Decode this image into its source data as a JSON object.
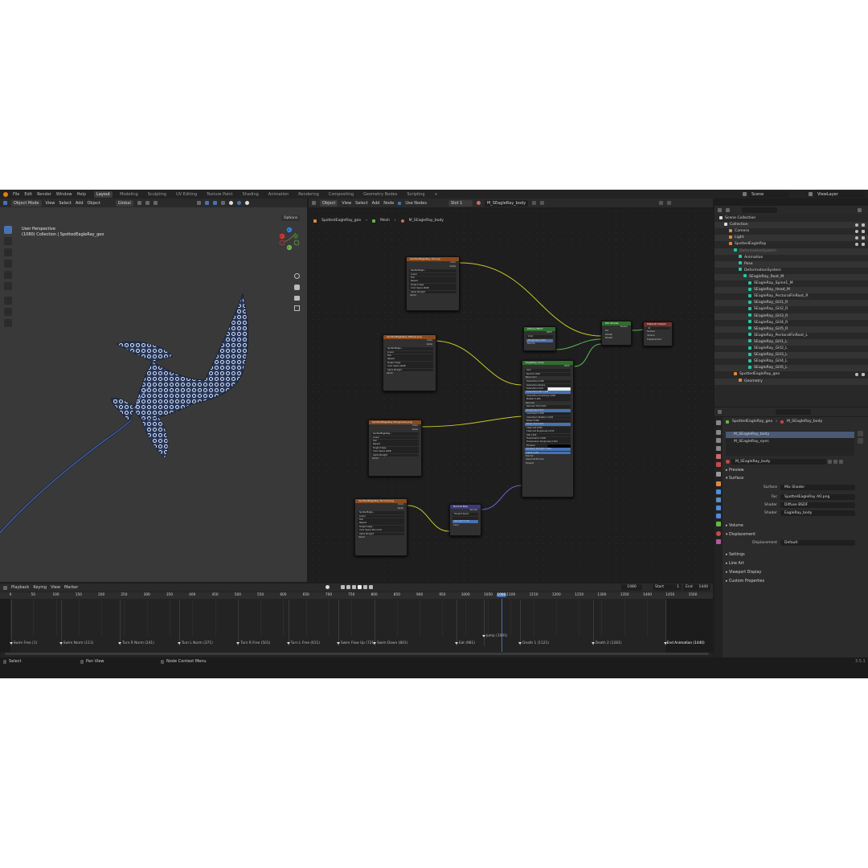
{
  "menu": [
    "File",
    "Edit",
    "Render",
    "Window",
    "Help"
  ],
  "workspaces": [
    "Layout",
    "Modeling",
    "Sculpting",
    "UV Editing",
    "Texture Paint",
    "Shading",
    "Animation",
    "Rendering",
    "Compositing",
    "Geometry Nodes",
    "Scripting",
    "+"
  ],
  "scene": {
    "name": "Scene",
    "view_layer": "ViewLayer"
  },
  "viewport": {
    "mode": "Object Mode",
    "menu": [
      "View",
      "Select",
      "Add",
      "Object"
    ],
    "orientation": "Global",
    "options": "Options",
    "title": "User Perspective",
    "subtitle": "(1080) Collection | SpottedEagleRay_geo",
    "gizmo": {
      "x": "X",
      "y": "Y",
      "z": "Z"
    }
  },
  "node_editor": {
    "type": "Object",
    "menu": [
      "View",
      "Select",
      "Add",
      "Node"
    ],
    "use_nodes": "Use Nodes",
    "slot": "Slot 1",
    "material": "M_SEagleRay_body",
    "breadcrumb": [
      "SpottedEagleRay_geo",
      "Mesh",
      "M_SEagleRay_body"
    ],
    "nodes": {
      "ao": {
        "title": "SpottedEagleRay AO.png",
        "outputs": [
          "Color",
          "Alpha"
        ],
        "file": "SpottedEagle...",
        "fields": [
          "Linear",
          "Flat",
          "Repeat",
          "Single Image",
          "Color Space   sRGB",
          "Alpha   Straight"
        ],
        "vector": "Vector"
      },
      "basecolor": {
        "title": "SpottedEagleRay Diffuse.png",
        "outputs": [
          "Color",
          "Alpha"
        ],
        "file": "SpottedEagle...",
        "fields": [
          "Linear",
          "Flat",
          "Repeat",
          "Single Image",
          "Color Space   sRGB",
          "Alpha   Straight"
        ],
        "vector": "Vector"
      },
      "roughness": {
        "title": "SpottedEagleRay Roughness.png",
        "outputs": [
          "Color",
          "Alpha"
        ],
        "file": "SpottedEagleRay...",
        "fields": [
          "Linear",
          "Flat",
          "Repeat",
          "Single Image",
          "Color Space   sRGB",
          "Alpha   Straight"
        ],
        "vector": "Vector"
      },
      "normal_tex": {
        "title": "SpottedEagleRay Normal.png",
        "outputs": [
          "Color",
          "Alpha"
        ],
        "file": "SpottedEagle...",
        "fields": [
          "Linear",
          "Flat",
          "Repeat",
          "Single Image",
          "Color Space   Non-Color",
          "Alpha   Straight"
        ],
        "vector": "Vector"
      },
      "diffuse": {
        "title": "Diffuse BSDF",
        "out": "BSDF",
        "rows": [
          "Color",
          "Roughness  0.000",
          "Normal"
        ]
      },
      "mix": {
        "title": "Mix Shader",
        "out": "Shader",
        "rows": [
          "Fac",
          "Shader",
          "Shader"
        ]
      },
      "output": {
        "title": "Material Output",
        "dropdown": "All",
        "rows": [
          "Surface",
          "Volume",
          "Displacement"
        ]
      },
      "bsdf": {
        "title": "EagleRay_body",
        "out": "BSDF",
        "dd1": "GGX",
        "dd2": "Random Walk",
        "rows": [
          "Base Color",
          "Subsurface  0.000",
          "Subsurface Radius",
          "Subsurface Color",
          "Subsurface IOR  1.400",
          "Subsurface Anisotropy  0.000",
          "Metallic  0.000",
          "Specular",
          "Specular Tint  0.000",
          "Roughness  0.517",
          "Anisotropic  0.000",
          "Anisotropic Rotation  0.000",
          "Sheen  0.000",
          "Sheen Tint  0.500",
          "Clearcoat  0.000",
          "Clearcoat Roughness  0.030",
          "IOR  1.450",
          "Transmission  0.000",
          "Transmission Roughness  0.000",
          "Emission",
          "Emission Strength  1.000",
          "Alpha  1.000",
          "Normal",
          "Clearcoat Normal",
          "Tangent"
        ]
      },
      "normalmap": {
        "title": "Normal Map",
        "out": "Normal",
        "dd": "Tangent Space",
        "rows": [
          "Strength  0.700",
          "Color"
        ]
      }
    }
  },
  "outliner": {
    "search_placeholder": "",
    "items": [
      {
        "label": "Scene Collection",
        "depth": 0,
        "icon": "collection-icon"
      },
      {
        "label": "Collection",
        "depth": 1,
        "icon": "collection-icon"
      },
      {
        "label": "Camera",
        "depth": 2,
        "icon": "camera-icon"
      },
      {
        "label": "Light",
        "depth": 2,
        "icon": "light-icon"
      },
      {
        "label": "SpottedEagleRay",
        "depth": 2,
        "icon": "armature-icon"
      },
      {
        "label": "DeformationSystem",
        "depth": 3,
        "icon": "bone-icon",
        "dim": true
      },
      {
        "label": "Animation",
        "depth": 4,
        "icon": "action-icon"
      },
      {
        "label": "Pose",
        "depth": 4,
        "icon": "pose-icon"
      },
      {
        "label": "DeformationSystem",
        "depth": 4,
        "icon": "bone-icon"
      },
      {
        "label": "SEagleRay_Root_M",
        "depth": 5,
        "icon": "bone-icon"
      },
      {
        "label": "SEagleRay_Spine1_M",
        "depth": 6,
        "icon": "bone-icon"
      },
      {
        "label": "SEagleRay_Head_M",
        "depth": 6,
        "icon": "bone-icon"
      },
      {
        "label": "SEagleRay_PectoralFinRoot_R",
        "depth": 6,
        "icon": "bone-icon"
      },
      {
        "label": "SEagleRay_Gill1_R",
        "depth": 6,
        "icon": "bone-icon"
      },
      {
        "label": "SEagleRay_Gill2_R",
        "depth": 6,
        "icon": "bone-icon"
      },
      {
        "label": "SEagleRay_Gill3_R",
        "depth": 6,
        "icon": "bone-icon"
      },
      {
        "label": "SEagleRay_Gill4_R",
        "depth": 6,
        "icon": "bone-icon"
      },
      {
        "label": "SEagleRay_Gill5_R",
        "depth": 6,
        "icon": "bone-icon"
      },
      {
        "label": "SEagleRay_PectoralFinRoot_L",
        "depth": 6,
        "icon": "bone-icon"
      },
      {
        "label": "SEagleRay_Gill1_L",
        "depth": 6,
        "icon": "bone-icon"
      },
      {
        "label": "SEagleRay_Gill2_L",
        "depth": 6,
        "icon": "bone-icon"
      },
      {
        "label": "SEagleRay_Gill3_L",
        "depth": 6,
        "icon": "bone-icon"
      },
      {
        "label": "SEagleRay_Gill4_L",
        "depth": 6,
        "icon": "bone-icon"
      },
      {
        "label": "SEagleRay_Gill5_L",
        "depth": 6,
        "icon": "bone-icon"
      },
      {
        "label": "SpottedEagleRay_geo",
        "depth": 3,
        "icon": "mesh-icon"
      },
      {
        "label": "Geometry",
        "depth": 4,
        "icon": "modifier-icon"
      }
    ]
  },
  "properties": {
    "breadcrumb": [
      "SpottedEagleRay_geo",
      "M_SEagleRay_body"
    ],
    "slots": [
      "M_SEagleRay_body",
      "M_SEagleRay_eyes"
    ],
    "material_name": "M_SEagleRay_body",
    "sections": {
      "preview": "Preview",
      "surface": "Surface",
      "volume": "Volume",
      "displacement": "Displacement",
      "settings": "Settings",
      "lineart": "Line Art",
      "viewport_display": "Viewport Display",
      "custom_props": "Custom Properties"
    },
    "surface": {
      "label": "Surface",
      "value": "Mix Shader"
    },
    "fac": {
      "label": "Fac",
      "value": "SpottedEagleRay AO.png"
    },
    "shader1": {
      "label": "Shader",
      "value": "Diffuse BSDF"
    },
    "shader2": {
      "label": "Shader",
      "value": "EagleRay_body"
    },
    "disp": {
      "label": "Displacement",
      "value": "Default"
    }
  },
  "timeline": {
    "menu": [
      "Playback",
      "Keying",
      "View",
      "Marker"
    ],
    "current_frame": "1080",
    "start_label": "Start",
    "start": "1",
    "end_label": "End",
    "end": "1440",
    "ticks": [
      "0",
      "50",
      "100",
      "150",
      "200",
      "250",
      "300",
      "350",
      "400",
      "450",
      "500",
      "550",
      "600",
      "650",
      "700",
      "750",
      "800",
      "850",
      "900",
      "950",
      "1000",
      "1050",
      "1080",
      "1100",
      "1150",
      "1200",
      "1250",
      "1300",
      "1350",
      "1400",
      "1450",
      "1500"
    ],
    "markers": [
      "Swim Free (1)",
      "Swim Norm (111)",
      "Turn R Norm (241)",
      "Turn L Norm (371)",
      "Turn R Free (501)",
      "Turn L Free (611)",
      "Swim Flow Up (721)",
      "Swim Down (801)",
      "Eat (981)",
      "Jump (1041)",
      "Death 1 (1121)",
      "Death 2 (1281)",
      "End Animation (1440)"
    ]
  },
  "status": {
    "select": "Select",
    "pan": "Pan View",
    "context": "Node Context Menu",
    "version": "3.5.1"
  },
  "colors": {
    "accent": "#4772b3",
    "image_node": "#8a4a1d",
    "shader_node": "#2e6d2e",
    "vector_node": "#3b3b7a",
    "output_node": "#7a2b2b",
    "yellow_link": "#c7c729",
    "green_link": "#58b85a",
    "purple_link": "#6363c7",
    "bone": "#26c6a0"
  }
}
